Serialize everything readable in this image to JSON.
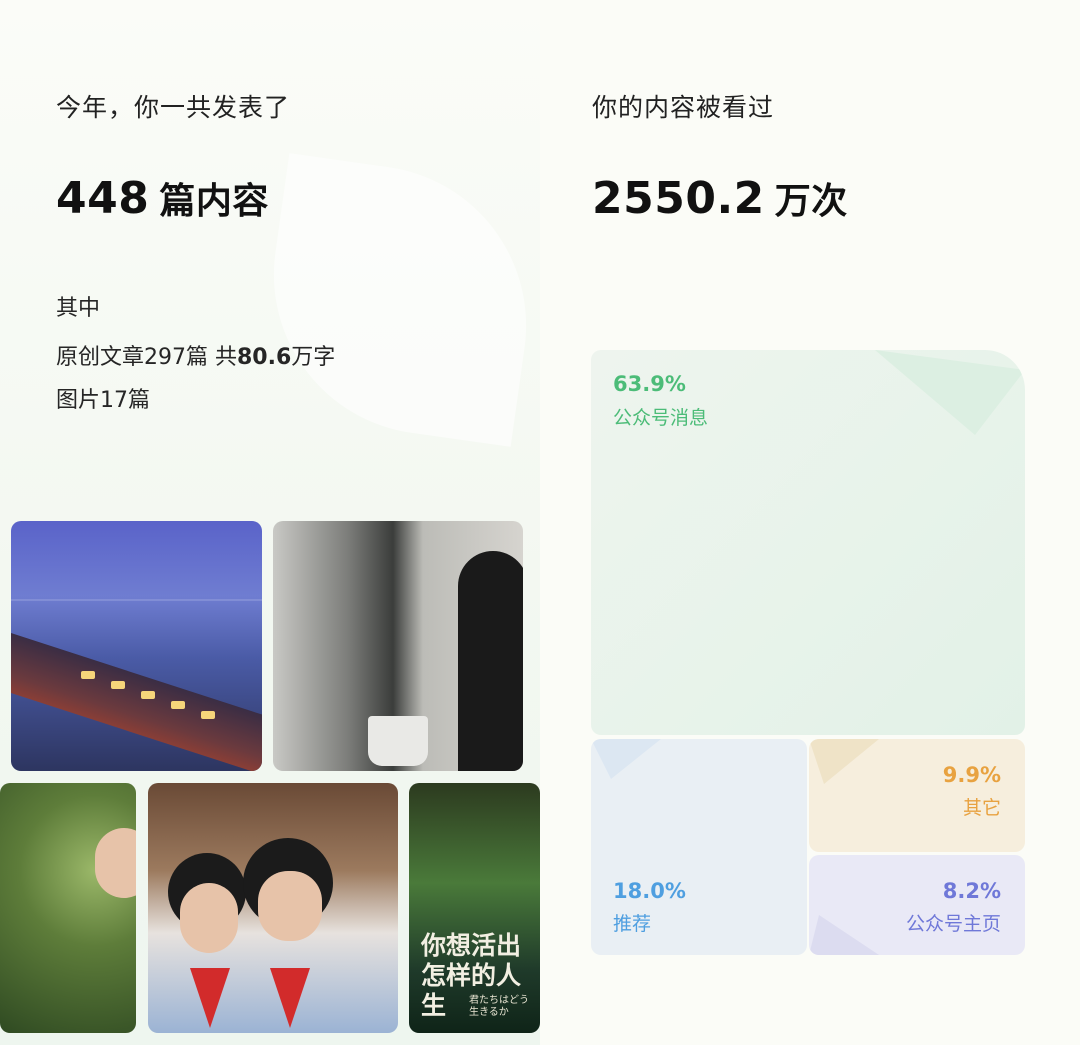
{
  "left": {
    "intro": "今年，你一共发表了",
    "total_number": "448",
    "total_unit": "篇内容",
    "breakdown_label": "其中",
    "original_prefix": "原创文章297篇 共",
    "original_words_number": "80.6",
    "original_words_unit": "万字",
    "images_line": "图片17篇",
    "poster_text": "你想活出怎样的人生",
    "poster_subtext": "君たちはどう生きるか"
  },
  "right": {
    "intro": "你的内容被看过",
    "total_number": "2550.2",
    "total_unit": "万次",
    "sources": [
      {
        "percent": "63.9%",
        "name": "公众号消息",
        "value": 63.9,
        "color": "#4cbc78"
      },
      {
        "percent": "18.0%",
        "name": "推荐",
        "value": 18.0,
        "color": "#4f9fe0"
      },
      {
        "percent": "9.9%",
        "name": "其它",
        "value": 9.9,
        "color": "#e8a240"
      },
      {
        "percent": "8.2%",
        "name": "公众号主页",
        "value": 8.2,
        "color": "#6f78d8"
      }
    ]
  },
  "icons": {
    "fold_corner": "page-fold-icon"
  }
}
